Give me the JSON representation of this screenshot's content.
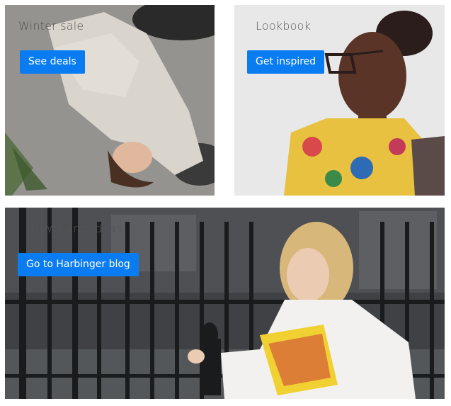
{
  "tiles": [
    {
      "title": "Winter sale",
      "button": "See deals"
    },
    {
      "title": "Lookbook",
      "button": "Get inspired"
    },
    {
      "title": "News and ideas",
      "button": "Go to Harbinger blog"
    }
  ],
  "colors": {
    "button": "#0a7cf2",
    "title": "#555555"
  }
}
